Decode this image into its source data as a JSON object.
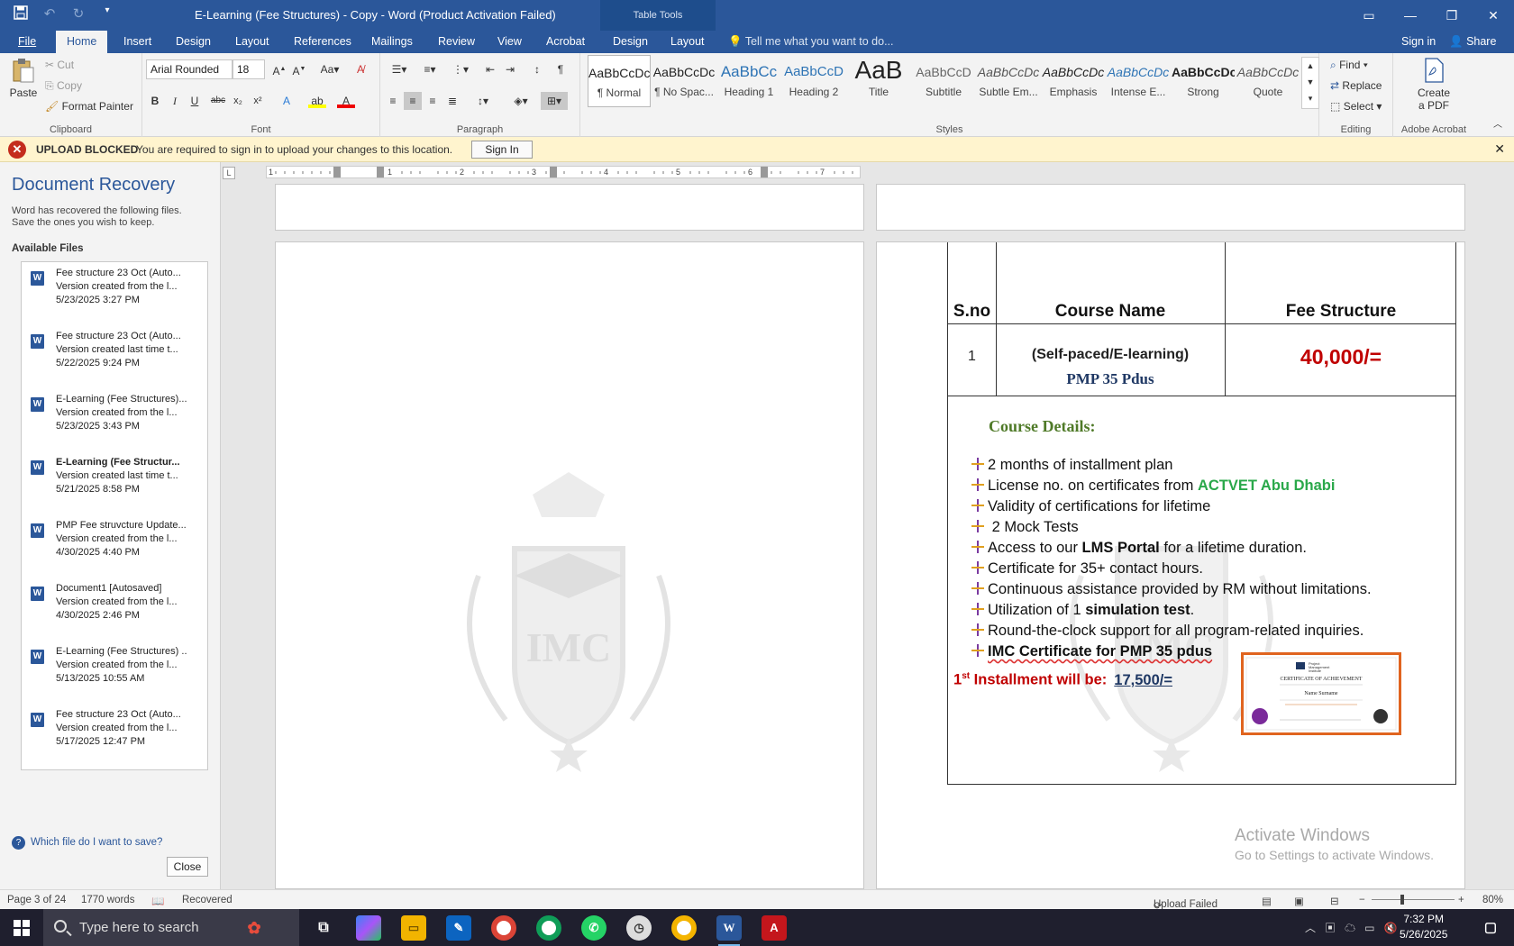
{
  "titlebar": {
    "doc_title": "E-Learning (Fee Structures) - Copy - Word (Product Activation Failed)",
    "table_tools": "Table Tools"
  },
  "tabs": [
    {
      "label": "File"
    },
    {
      "label": "Home"
    },
    {
      "label": "Insert"
    },
    {
      "label": "Design"
    },
    {
      "label": "Layout"
    },
    {
      "label": "References"
    },
    {
      "label": "Mailings"
    },
    {
      "label": "Review"
    },
    {
      "label": "View"
    },
    {
      "label": "Acrobat"
    },
    {
      "label": "Design"
    },
    {
      "label": "Layout"
    }
  ],
  "tell_me": "Tell me what you want to do...",
  "sign_in": "Sign in",
  "share": "Share",
  "ribbon": {
    "clipboard": {
      "paste": "Paste",
      "cut": "Cut",
      "copy": "Copy",
      "format_painter": "Format Painter",
      "label": "Clipboard"
    },
    "font": {
      "name": "Arial Rounded",
      "size": "18",
      "label": "Font"
    },
    "paragraph": {
      "label": "Paragraph"
    },
    "styles": {
      "label": "Styles",
      "items": [
        {
          "preview": "AaBbCcDc",
          "name": "¶ Normal"
        },
        {
          "preview": "AaBbCcDc",
          "name": "¶ No Spac..."
        },
        {
          "preview": "AaBbCc",
          "name": "Heading 1"
        },
        {
          "preview": "AaBbCcD",
          "name": "Heading 2"
        },
        {
          "preview": "AaB",
          "name": "Title"
        },
        {
          "preview": "AaBbCcD",
          "name": "Subtitle"
        },
        {
          "preview": "AaBbCcDc",
          "name": "Subtle Em..."
        },
        {
          "preview": "AaBbCcDc",
          "name": "Emphasis"
        },
        {
          "preview": "AaBbCcDc",
          "name": "Intense E..."
        },
        {
          "preview": "AaBbCcDc",
          "name": "Strong"
        },
        {
          "preview": "AaBbCcDc",
          "name": "Quote"
        }
      ]
    },
    "editing": {
      "find": "Find",
      "replace": "Replace",
      "select": "Select",
      "label": "Editing"
    },
    "acrobat": {
      "create_pdf_1": "Create",
      "create_pdf_2": "a PDF",
      "label": "Adobe Acrobat"
    }
  },
  "message_bar": {
    "title": "UPLOAD BLOCKED",
    "text": "You are required to sign in to upload your changes to this location.",
    "button": "Sign In"
  },
  "recovery": {
    "heading": "Document Recovery",
    "desc_1": "Word has recovered the following files.",
    "desc_2": "Save the ones you wish to keep.",
    "available": "Available Files",
    "files": [
      {
        "name": "Fee structure 23 Oct (Auto...",
        "note": "Version created from the l...",
        "date": "5/23/2025 3:27 PM",
        "bold": false
      },
      {
        "name": "Fee structure 23 Oct (Auto...",
        "note": "Version created last time t...",
        "date": "5/22/2025 9:24 PM",
        "bold": false
      },
      {
        "name": "E-Learning (Fee Structures)...",
        "note": "Version created from the l...",
        "date": "5/23/2025 3:43 PM",
        "bold": false
      },
      {
        "name": "E-Learning (Fee Structur...",
        "note": "Version created last time t...",
        "date": "5/21/2025 8:58 PM",
        "bold": true
      },
      {
        "name": "PMP Fee struvcture Update...",
        "note": "Version created from the l...",
        "date": "4/30/2025 4:40 PM",
        "bold": false
      },
      {
        "name": "Document1  [Autosaved]",
        "note": "Version created from the l...",
        "date": "4/30/2025 2:46 PM",
        "bold": false
      },
      {
        "name": "E-Learning (Fee Structures) ..",
        "note": "Version created from the l...",
        "date": "5/13/2025 10:55 AM",
        "bold": false
      },
      {
        "name": "Fee structure 23 Oct (Auto...",
        "note": "Version created from the l...",
        "date": "5/17/2025 12:47 PM",
        "bold": false
      }
    ],
    "help": "Which file do I want to save?",
    "close": "Close"
  },
  "document": {
    "watermark": "IMC",
    "table": {
      "headers": [
        "S.no",
        "Course Name",
        "Fee Structure"
      ],
      "row": {
        "sno": "1",
        "course_line1": "(Self-paced/E-learning)",
        "course_line2": "PMP 35 Pdus",
        "fee": "40,000/="
      }
    },
    "details_title": "Course Details:",
    "bullets": [
      {
        "pre": "2 months of installment plan",
        "bold": "",
        "post": "",
        "green": ""
      },
      {
        "pre": "License no. on certificates from ",
        "bold": "",
        "post": "",
        "green": "ACTVET Abu Dhabi"
      },
      {
        "pre": "Validity of certifications for lifetime",
        "bold": "",
        "post": "",
        "green": ""
      },
      {
        "pre": " 2 Mock Tests",
        "bold": "",
        "post": "",
        "green": ""
      },
      {
        "pre": "Access to our ",
        "bold": "LMS Portal",
        "post": " for a lifetime duration.",
        "green": ""
      },
      {
        "pre": "Certificate for 35+ contact hours.",
        "bold": "",
        "post": "",
        "green": ""
      },
      {
        "pre": "Continuous assistance provided by RM without limitations.",
        "bold": "",
        "post": "",
        "green": ""
      },
      {
        "pre": "Utilization of 1 ",
        "bold": "simulation test",
        "post": ".",
        "green": ""
      },
      {
        "pre": "Round-the-clock support for all program-related inquiries.",
        "bold": "",
        "post": "",
        "green": ""
      },
      {
        "pre": "",
        "bold": "IMC Certificate for PMP 35 pdus",
        "post": "",
        "green": ""
      }
    ],
    "installment_num": "1",
    "installment_sup": "st",
    "installment_label": " Installment will be:",
    "installment_amount": "17,500/=",
    "certificate": {
      "title": "CERTIFICATE OF ACHIEVEMENT",
      "name": "Name Surname",
      "org_1": "Project",
      "org_2": "Management",
      "org_3": "Institute"
    }
  },
  "activate": {
    "line1": "Activate Windows",
    "line2": "Go to Settings to activate Windows."
  },
  "status": {
    "page": "Page 3 of 24",
    "words": "1770 words",
    "recovered": "Recovered",
    "upload": "Upload Failed",
    "zoom": "80%"
  },
  "taskbar": {
    "search": "Type here to search",
    "time": "7:32 PM",
    "date": "5/26/2025"
  },
  "colors": {
    "word_blue": "#2b579a",
    "fee_red": "#c00000",
    "course_navy": "#1f3864",
    "actvet_green": "#2aa84a",
    "details_green": "#4f7a28"
  }
}
